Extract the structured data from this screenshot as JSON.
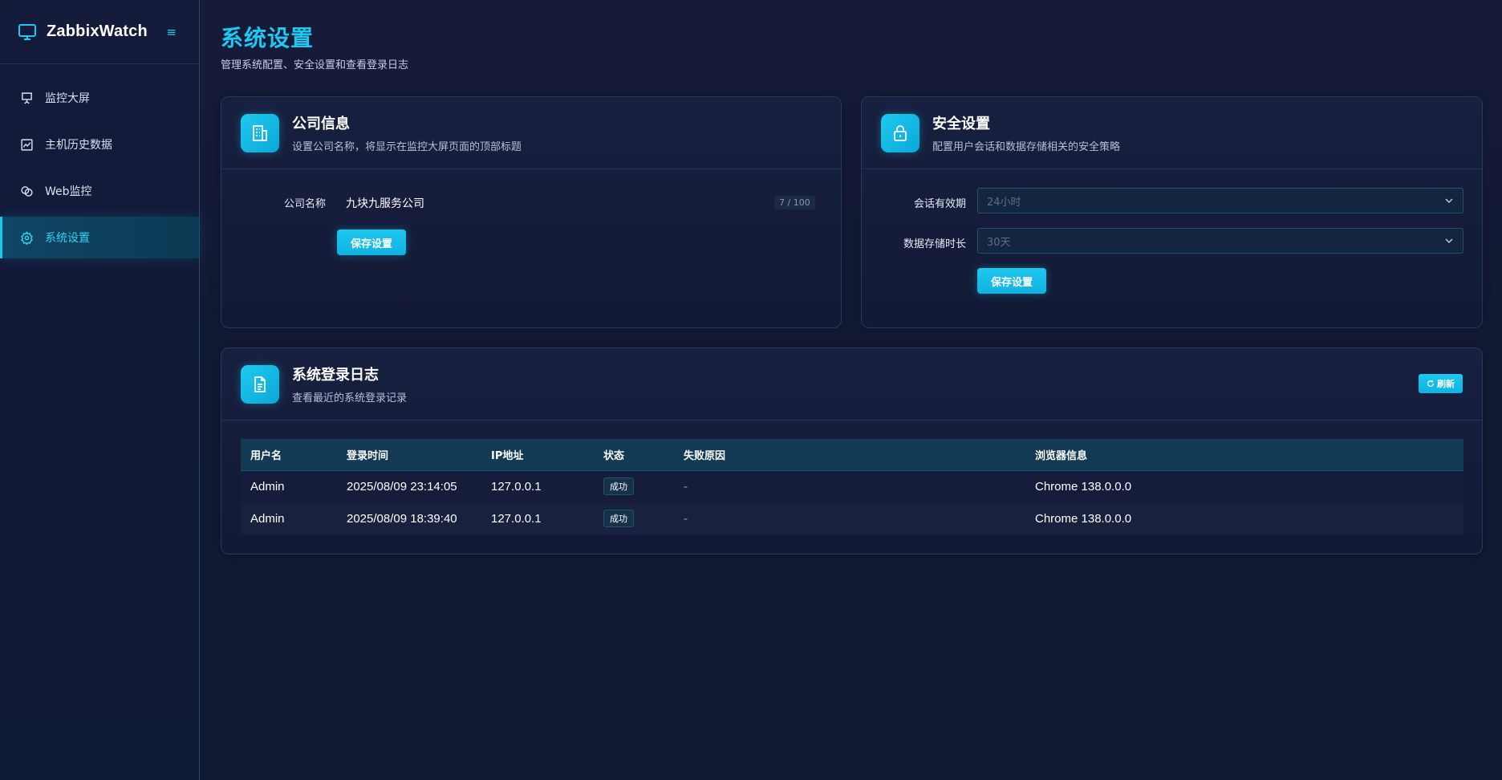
{
  "brand": {
    "name": "ZabbixWatch",
    "toggle_icon": "≡"
  },
  "sidebar": {
    "items": [
      {
        "label": "监控大屏",
        "icon": "presentation-icon",
        "active": false
      },
      {
        "label": "主机历史数据",
        "icon": "chart-icon",
        "active": false
      },
      {
        "label": "Web监控",
        "icon": "link-icon",
        "active": false
      },
      {
        "label": "系统设置",
        "icon": "gear-icon",
        "active": true
      }
    ]
  },
  "page": {
    "title": "系统设置",
    "subtitle": "管理系统配置、安全设置和查看登录日志"
  },
  "company": {
    "title": "公司信息",
    "desc": "设置公司名称，将显示在监控大屏页面的顶部标题",
    "field_label": "公司名称",
    "field_value": "九块九服务公司",
    "counter": "7 / 100",
    "save_label": "保存设置"
  },
  "security": {
    "title": "安全设置",
    "desc": "配置用户会话和数据存储相关的安全策略",
    "session_label": "会话有效期",
    "session_value": "24小时",
    "storage_label": "数据存储时长",
    "storage_value": "30天",
    "save_label": "保存设置"
  },
  "logs": {
    "title": "系统登录日志",
    "desc": "查看最近的系统登录记录",
    "refresh_label": "刷新",
    "columns": [
      "用户名",
      "登录时间",
      "IP地址",
      "状态",
      "失败原因",
      "浏览器信息"
    ],
    "rows": [
      {
        "user": "Admin",
        "time": "2025/08/09 23:14:05",
        "ip": "127.0.0.1",
        "status": "成功",
        "reason": "-",
        "browser": "Chrome 138.0.0.0"
      },
      {
        "user": "Admin",
        "time": "2025/08/09 18:39:40",
        "ip": "127.0.0.1",
        "status": "成功",
        "reason": "-",
        "browser": "Chrome 138.0.0.0"
      }
    ]
  },
  "colors": {
    "accent": "#1ec8f0",
    "background": "#121a33",
    "card_border": "#1f3d5e"
  }
}
